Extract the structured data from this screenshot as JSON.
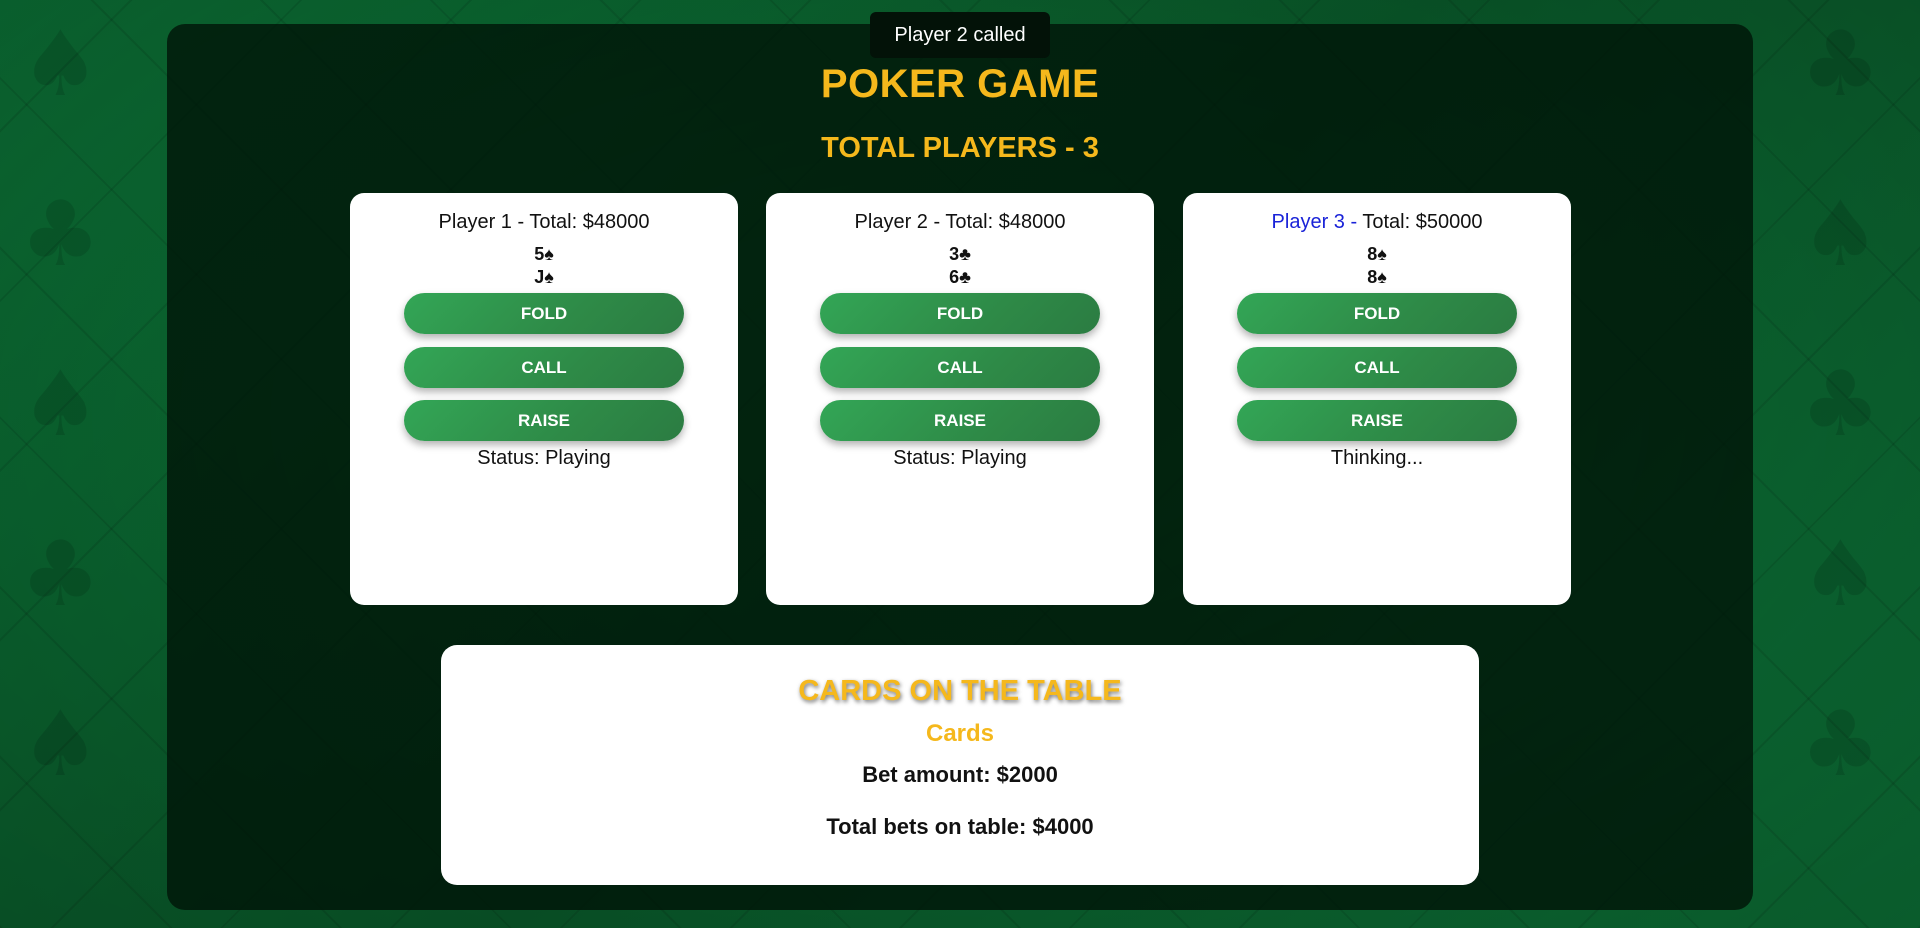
{
  "toast": "Player 2 called",
  "title": "POKER GAME",
  "subtitle": "TOTAL PLAYERS - 3",
  "colors": {
    "accent": "#f5b81c",
    "button_green": "#2e8a47",
    "active_player": "#1a23d8",
    "felt": "#0f6b34"
  },
  "players": [
    {
      "name": "Player 1",
      "separator": " - ",
      "total": "Total: $48000",
      "cards": [
        "5♠",
        "J♠"
      ],
      "fold_label": "FOLD",
      "call_label": "CALL",
      "raise_label": "RAISE",
      "status": "Status: Playing"
    },
    {
      "name": "Player 2",
      "separator": " - ",
      "total": "Total: $48000",
      "cards": [
        "3♣",
        "6♣"
      ],
      "fold_label": "FOLD",
      "call_label": "CALL",
      "raise_label": "RAISE",
      "status": "Status: Playing"
    },
    {
      "name": "Player 3",
      "separator": " - ",
      "total": "Total: $50000",
      "cards": [
        "8♠",
        "8♠"
      ],
      "fold_label": "FOLD",
      "call_label": "CALL",
      "raise_label": "RAISE",
      "status": "Thinking..."
    }
  ],
  "table": {
    "title": "CARDS ON THE TABLE",
    "cards_label": "Cards",
    "bet_amount": "Bet amount: $2000",
    "total_bets": "Total bets on table: $4000"
  }
}
